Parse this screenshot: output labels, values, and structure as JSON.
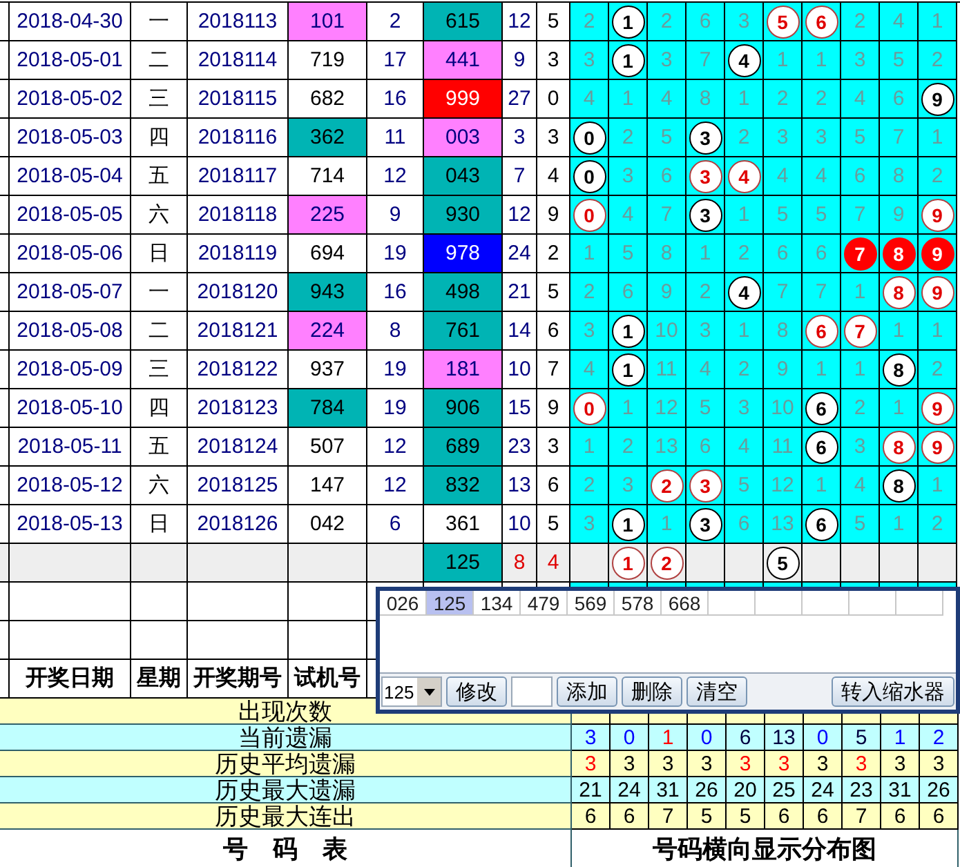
{
  "draw_table": {
    "rows": [
      {
        "date": "2018-04-30",
        "weekday": "一",
        "issue": "2018113",
        "trial": {
          "text": "101",
          "color": "#ff80ff"
        },
        "sum": "2",
        "result": {
          "text": "615",
          "color": "#00b4b4"
        },
        "span": "12",
        "last": "5"
      },
      {
        "date": "2018-05-01",
        "weekday": "二",
        "issue": "2018114",
        "trial": {
          "text": "719"
        },
        "sum": "17",
        "result": {
          "text": "441",
          "color": "#ff80ff"
        },
        "span": "9",
        "last": "3"
      },
      {
        "date": "2018-05-02",
        "weekday": "三",
        "issue": "2018115",
        "trial": {
          "text": "682"
        },
        "sum": "16",
        "result": {
          "text": "999",
          "color": "#ff0000"
        },
        "span": "27",
        "last": "0"
      },
      {
        "date": "2018-05-03",
        "weekday": "四",
        "issue": "2018116",
        "trial": {
          "text": "362",
          "color": "#00b4b4"
        },
        "sum": "11",
        "result": {
          "text": "003",
          "color": "#ff80ff"
        },
        "span": "3",
        "last": "3"
      },
      {
        "date": "2018-05-04",
        "weekday": "五",
        "issue": "2018117",
        "trial": {
          "text": "714"
        },
        "sum": "12",
        "result": {
          "text": "043",
          "color": "#00b4b4"
        },
        "span": "7",
        "last": "4"
      },
      {
        "date": "2018-05-05",
        "weekday": "六",
        "issue": "2018118",
        "trial": {
          "text": "225",
          "color": "#ff80ff"
        },
        "sum": "9",
        "result": {
          "text": "930",
          "color": "#00b4b4"
        },
        "span": "12",
        "last": "9"
      },
      {
        "date": "2018-05-06",
        "weekday": "日",
        "issue": "2018119",
        "trial": {
          "text": "694"
        },
        "sum": "19",
        "result": {
          "text": "978",
          "color": "#0000ff"
        },
        "span": "24",
        "last": "2"
      },
      {
        "date": "2018-05-07",
        "weekday": "一",
        "issue": "2018120",
        "trial": {
          "text": "943",
          "color": "#00b4b4"
        },
        "sum": "16",
        "result": {
          "text": "498",
          "color": "#00b4b4"
        },
        "span": "21",
        "last": "5"
      },
      {
        "date": "2018-05-08",
        "weekday": "二",
        "issue": "2018121",
        "trial": {
          "text": "224",
          "color": "#ff80ff"
        },
        "sum": "8",
        "result": {
          "text": "761",
          "color": "#00b4b4"
        },
        "span": "14",
        "last": "6"
      },
      {
        "date": "2018-05-09",
        "weekday": "三",
        "issue": "2018122",
        "trial": {
          "text": "937"
        },
        "sum": "19",
        "result": {
          "text": "181",
          "color": "#ff80ff"
        },
        "span": "10",
        "last": "7"
      },
      {
        "date": "2018-05-10",
        "weekday": "四",
        "issue": "2018123",
        "trial": {
          "text": "784",
          "color": "#00b4b4"
        },
        "sum": "19",
        "result": {
          "text": "906",
          "color": "#00b4b4"
        },
        "span": "15",
        "last": "9"
      },
      {
        "date": "2018-05-11",
        "weekday": "五",
        "issue": "2018124",
        "trial": {
          "text": "507"
        },
        "sum": "12",
        "result": {
          "text": "689",
          "color": "#00b4b4"
        },
        "span": "23",
        "last": "3"
      },
      {
        "date": "2018-05-12",
        "weekday": "六",
        "issue": "2018125",
        "trial": {
          "text": "147"
        },
        "sum": "12",
        "result": {
          "text": "832",
          "color": "#00b4b4"
        },
        "span": "13",
        "last": "6"
      },
      {
        "date": "2018-05-13",
        "weekday": "日",
        "issue": "2018126",
        "trial": {
          "text": "042"
        },
        "sum": "6",
        "result": {
          "text": "361"
        },
        "span": "10",
        "last": "5"
      }
    ],
    "summary": {
      "result": {
        "text": "125",
        "color": "#00b4b4"
      },
      "span": "8",
      "last": "4"
    },
    "header": [
      "开奖日期",
      "星期",
      "开奖期号",
      "试机号"
    ],
    "title": "号　码　表"
  },
  "distribution": {
    "rows": [
      [
        {
          "text": "2",
          "kind": "miss"
        },
        {
          "text": "1",
          "kind": "ball"
        },
        {
          "text": "2",
          "kind": "miss"
        },
        {
          "text": "6",
          "kind": "miss"
        },
        {
          "text": "3",
          "kind": "miss"
        },
        {
          "text": "5",
          "kind": "ball-red"
        },
        {
          "text": "6",
          "kind": "ball-red"
        },
        {
          "text": "2",
          "kind": "miss"
        },
        {
          "text": "4",
          "kind": "miss"
        },
        {
          "text": "1",
          "kind": "miss"
        }
      ],
      [
        {
          "text": "3",
          "kind": "miss"
        },
        {
          "text": "1",
          "kind": "ball"
        },
        {
          "text": "3",
          "kind": "miss"
        },
        {
          "text": "7",
          "kind": "miss"
        },
        {
          "text": "4",
          "kind": "ball"
        },
        {
          "text": "1",
          "kind": "miss"
        },
        {
          "text": "1",
          "kind": "miss"
        },
        {
          "text": "3",
          "kind": "miss"
        },
        {
          "text": "5",
          "kind": "miss"
        },
        {
          "text": "2",
          "kind": "miss"
        }
      ],
      [
        {
          "text": "4",
          "kind": "miss"
        },
        {
          "text": "1",
          "kind": "miss"
        },
        {
          "text": "4",
          "kind": "miss"
        },
        {
          "text": "8",
          "kind": "miss"
        },
        {
          "text": "1",
          "kind": "miss"
        },
        {
          "text": "2",
          "kind": "miss"
        },
        {
          "text": "2",
          "kind": "miss"
        },
        {
          "text": "4",
          "kind": "miss"
        },
        {
          "text": "6",
          "kind": "miss"
        },
        {
          "text": "9",
          "kind": "ball"
        }
      ],
      [
        {
          "text": "0",
          "kind": "ball"
        },
        {
          "text": "2",
          "kind": "miss"
        },
        {
          "text": "5",
          "kind": "miss"
        },
        {
          "text": "3",
          "kind": "ball"
        },
        {
          "text": "2",
          "kind": "miss"
        },
        {
          "text": "3",
          "kind": "miss"
        },
        {
          "text": "3",
          "kind": "miss"
        },
        {
          "text": "5",
          "kind": "miss"
        },
        {
          "text": "7",
          "kind": "miss"
        },
        {
          "text": "1",
          "kind": "miss"
        }
      ],
      [
        {
          "text": "0",
          "kind": "ball"
        },
        {
          "text": "3",
          "kind": "miss"
        },
        {
          "text": "6",
          "kind": "miss"
        },
        {
          "text": "3",
          "kind": "ball-red"
        },
        {
          "text": "4",
          "kind": "ball-red"
        },
        {
          "text": "4",
          "kind": "miss"
        },
        {
          "text": "4",
          "kind": "miss"
        },
        {
          "text": "6",
          "kind": "miss"
        },
        {
          "text": "8",
          "kind": "miss"
        },
        {
          "text": "2",
          "kind": "miss"
        }
      ],
      [
        {
          "text": "0",
          "kind": "ball-red"
        },
        {
          "text": "4",
          "kind": "miss"
        },
        {
          "text": "7",
          "kind": "miss"
        },
        {
          "text": "3",
          "kind": "ball"
        },
        {
          "text": "1",
          "kind": "miss"
        },
        {
          "text": "5",
          "kind": "miss"
        },
        {
          "text": "5",
          "kind": "miss"
        },
        {
          "text": "7",
          "kind": "miss"
        },
        {
          "text": "9",
          "kind": "miss"
        },
        {
          "text": "9",
          "kind": "ball-red"
        }
      ],
      [
        {
          "text": "1",
          "kind": "miss"
        },
        {
          "text": "5",
          "kind": "miss"
        },
        {
          "text": "8",
          "kind": "miss"
        },
        {
          "text": "1",
          "kind": "miss"
        },
        {
          "text": "2",
          "kind": "miss"
        },
        {
          "text": "6",
          "kind": "miss"
        },
        {
          "text": "6",
          "kind": "miss"
        },
        {
          "text": "7",
          "kind": "ball-solid"
        },
        {
          "text": "8",
          "kind": "ball-solid"
        },
        {
          "text": "9",
          "kind": "ball-solid"
        }
      ],
      [
        {
          "text": "2",
          "kind": "miss"
        },
        {
          "text": "6",
          "kind": "miss"
        },
        {
          "text": "9",
          "kind": "miss"
        },
        {
          "text": "2",
          "kind": "miss"
        },
        {
          "text": "4",
          "kind": "ball"
        },
        {
          "text": "7",
          "kind": "miss"
        },
        {
          "text": "7",
          "kind": "miss"
        },
        {
          "text": "1",
          "kind": "miss"
        },
        {
          "text": "8",
          "kind": "ball-red"
        },
        {
          "text": "9",
          "kind": "ball-red"
        }
      ],
      [
        {
          "text": "3",
          "kind": "miss"
        },
        {
          "text": "1",
          "kind": "ball"
        },
        {
          "text": "10",
          "kind": "miss"
        },
        {
          "text": "3",
          "kind": "miss"
        },
        {
          "text": "1",
          "kind": "miss"
        },
        {
          "text": "8",
          "kind": "miss"
        },
        {
          "text": "6",
          "kind": "ball-red"
        },
        {
          "text": "7",
          "kind": "ball-red"
        },
        {
          "text": "1",
          "kind": "miss"
        },
        {
          "text": "1",
          "kind": "miss"
        }
      ],
      [
        {
          "text": "4",
          "kind": "miss"
        },
        {
          "text": "1",
          "kind": "ball"
        },
        {
          "text": "11",
          "kind": "miss"
        },
        {
          "text": "4",
          "kind": "miss"
        },
        {
          "text": "2",
          "kind": "miss"
        },
        {
          "text": "9",
          "kind": "miss"
        },
        {
          "text": "1",
          "kind": "miss"
        },
        {
          "text": "1",
          "kind": "miss"
        },
        {
          "text": "8",
          "kind": "ball"
        },
        {
          "text": "2",
          "kind": "miss"
        }
      ],
      [
        {
          "text": "0",
          "kind": "ball-red"
        },
        {
          "text": "1",
          "kind": "miss"
        },
        {
          "text": "12",
          "kind": "miss"
        },
        {
          "text": "5",
          "kind": "miss"
        },
        {
          "text": "3",
          "kind": "miss"
        },
        {
          "text": "10",
          "kind": "miss"
        },
        {
          "text": "6",
          "kind": "ball"
        },
        {
          "text": "2",
          "kind": "miss"
        },
        {
          "text": "1",
          "kind": "miss"
        },
        {
          "text": "9",
          "kind": "ball-red"
        }
      ],
      [
        {
          "text": "1",
          "kind": "miss"
        },
        {
          "text": "2",
          "kind": "miss"
        },
        {
          "text": "13",
          "kind": "miss"
        },
        {
          "text": "6",
          "kind": "miss"
        },
        {
          "text": "4",
          "kind": "miss"
        },
        {
          "text": "11",
          "kind": "miss"
        },
        {
          "text": "6",
          "kind": "ball"
        },
        {
          "text": "3",
          "kind": "miss"
        },
        {
          "text": "8",
          "kind": "ball-red"
        },
        {
          "text": "9",
          "kind": "ball-red"
        }
      ],
      [
        {
          "text": "2",
          "kind": "miss"
        },
        {
          "text": "3",
          "kind": "miss"
        },
        {
          "text": "2",
          "kind": "ball-red"
        },
        {
          "text": "3",
          "kind": "ball-red"
        },
        {
          "text": "5",
          "kind": "miss"
        },
        {
          "text": "12",
          "kind": "miss"
        },
        {
          "text": "1",
          "kind": "miss"
        },
        {
          "text": "4",
          "kind": "miss"
        },
        {
          "text": "8",
          "kind": "ball"
        },
        {
          "text": "1",
          "kind": "miss"
        }
      ],
      [
        {
          "text": "3",
          "kind": "miss"
        },
        {
          "text": "1",
          "kind": "ball"
        },
        {
          "text": "1",
          "kind": "miss"
        },
        {
          "text": "3",
          "kind": "ball"
        },
        {
          "text": "6",
          "kind": "miss"
        },
        {
          "text": "13",
          "kind": "miss"
        },
        {
          "text": "6",
          "kind": "ball"
        },
        {
          "text": "5",
          "kind": "miss"
        },
        {
          "text": "1",
          "kind": "miss"
        },
        {
          "text": "2",
          "kind": "miss"
        }
      ]
    ],
    "summary": [
      {
        "kind": "empty"
      },
      {
        "text": "1",
        "kind": "ball-red"
      },
      {
        "text": "2",
        "kind": "ball-red"
      },
      {
        "kind": "empty"
      },
      {
        "kind": "empty"
      },
      {
        "text": "5",
        "kind": "ball"
      },
      {
        "kind": "empty"
      },
      {
        "kind": "empty"
      },
      {
        "kind": "empty"
      },
      {
        "kind": "empty"
      }
    ],
    "title": "号码横向显示分布图"
  },
  "stats": [
    {
      "label": "出现次数"
    },
    {
      "label": "当前遗漏",
      "values": [
        {
          "text": "3",
          "color": "#0000ff"
        },
        {
          "text": "0",
          "color": "#0000ff"
        },
        {
          "text": "1",
          "color": "#ff0000"
        },
        {
          "text": "0",
          "color": "#0000ff"
        },
        {
          "text": "6",
          "color": "#000040"
        },
        {
          "text": "13",
          "color": "#000040"
        },
        {
          "text": "0",
          "color": "#0000ff"
        },
        {
          "text": "5",
          "color": "#000040"
        },
        {
          "text": "1",
          "color": "#0000ff"
        },
        {
          "text": "2",
          "color": "#0000ff"
        }
      ]
    },
    {
      "label": "历史平均遗漏",
      "values": [
        {
          "text": "3",
          "color": "#ff0000"
        },
        {
          "text": "3",
          "color": "#000000"
        },
        {
          "text": "3",
          "color": "#000000"
        },
        {
          "text": "3",
          "color": "#000000"
        },
        {
          "text": "3",
          "color": "#ff0000"
        },
        {
          "text": "3",
          "color": "#ff0000"
        },
        {
          "text": "3",
          "color": "#000000"
        },
        {
          "text": "3",
          "color": "#ff0000"
        },
        {
          "text": "3",
          "color": "#000000"
        },
        {
          "text": "3",
          "color": "#000000"
        }
      ]
    },
    {
      "label": "历史最大遗漏",
      "values": [
        {
          "text": "21",
          "color": "#000000"
        },
        {
          "text": "24",
          "color": "#000000"
        },
        {
          "text": "31",
          "color": "#000000"
        },
        {
          "text": "26",
          "color": "#000000"
        },
        {
          "text": "20",
          "color": "#000000"
        },
        {
          "text": "25",
          "color": "#000000"
        },
        {
          "text": "24",
          "color": "#000000"
        },
        {
          "text": "23",
          "color": "#000000"
        },
        {
          "text": "31",
          "color": "#000000"
        },
        {
          "text": "26",
          "color": "#000000"
        }
      ]
    },
    {
      "label": "历史最大连出",
      "values": [
        {
          "text": "6",
          "color": "#000000"
        },
        {
          "text": "6",
          "color": "#000000"
        },
        {
          "text": "7",
          "color": "#000000"
        },
        {
          "text": "5",
          "color": "#000000"
        },
        {
          "text": "5",
          "color": "#000000"
        },
        {
          "text": "6",
          "color": "#000000"
        },
        {
          "text": "6",
          "color": "#000000"
        },
        {
          "text": "7",
          "color": "#000000"
        },
        {
          "text": "6",
          "color": "#000000"
        },
        {
          "text": "6",
          "color": "#000000"
        }
      ]
    }
  ],
  "number_picker": {
    "items": [
      {
        "text": "026",
        "selected": false
      },
      {
        "text": "125",
        "selected": true
      },
      {
        "text": "134",
        "selected": false
      },
      {
        "text": "479",
        "selected": false
      },
      {
        "text": "569",
        "selected": false
      },
      {
        "text": "578",
        "selected": false
      },
      {
        "text": "668",
        "selected": false
      }
    ],
    "toolbar": [
      {
        "kind": "select",
        "value": "125"
      },
      {
        "kind": "button",
        "label": "修改"
      },
      {
        "kind": "input"
      },
      {
        "kind": "button",
        "label": "添加"
      },
      {
        "kind": "button",
        "label": "删除"
      },
      {
        "kind": "button",
        "label": "清空"
      },
      {
        "kind": "button",
        "label": "转入缩水器"
      }
    ]
  }
}
